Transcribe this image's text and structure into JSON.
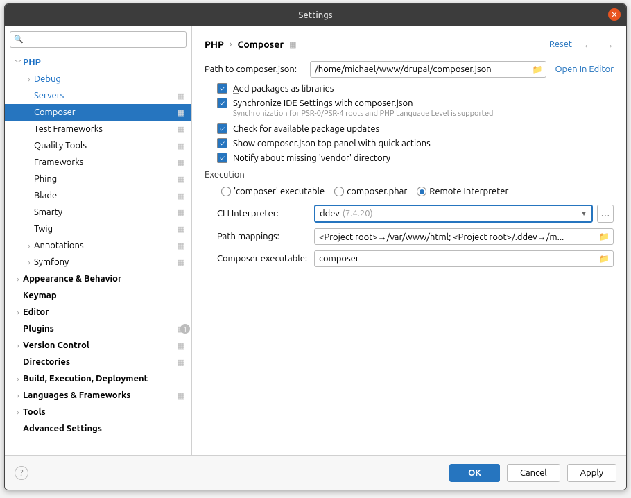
{
  "window_title": "Settings",
  "search_placeholder": "",
  "tree": {
    "php": "PHP",
    "debug": "Debug",
    "servers": "Servers",
    "composer": "Composer",
    "test_frameworks": "Test Frameworks",
    "quality_tools": "Quality Tools",
    "frameworks": "Frameworks",
    "phing": "Phing",
    "blade": "Blade",
    "smarty": "Smarty",
    "twig": "Twig",
    "annotations": "Annotations",
    "symfony": "Symfony",
    "appearance": "Appearance & Behavior",
    "keymap": "Keymap",
    "editor": "Editor",
    "plugins": "Plugins",
    "plugins_badge": "1",
    "vcs": "Version Control",
    "directories": "Directories",
    "build": "Build, Execution, Deployment",
    "languages": "Languages & Frameworks",
    "tools": "Tools",
    "advanced": "Advanced Settings"
  },
  "breadcrumb": {
    "a": "PHP",
    "b": "Composer"
  },
  "reset": "Reset",
  "path_label": "Path to composer.json:",
  "path_value": "/home/michael/www/drupal/composer.json",
  "open_in_editor": "Open In Editor",
  "chk_add": "dd packages as libraries",
  "chk_sync": "ynchronize IDE Settings with composer.json",
  "sync_hint": "Synchronization for PSR-0/PSR-4 roots and PHP Language Level is supported",
  "chk_check": "Check for available package updates",
  "chk_top": "Show composer.json top panel with quick actions",
  "chk_vendor": "Notify about missing 'vendor' directory",
  "execution": "Execution",
  "r1": "'composer' executable",
  "r2": "composer.phar",
  "r3": "Remote Interpreter",
  "cli_label": "CLI Interpreter:",
  "cli_name": "ddev",
  "cli_ver": "(7.4.20)",
  "map_label": "Path mappings:",
  "map_value": "<Project root>→/var/www/html; <Project root>/.ddev→/m...",
  "exec_label": "Composer executable:",
  "exec_value": "composer",
  "ok": "OK",
  "cancel": "Cancel",
  "apply": "Apply"
}
